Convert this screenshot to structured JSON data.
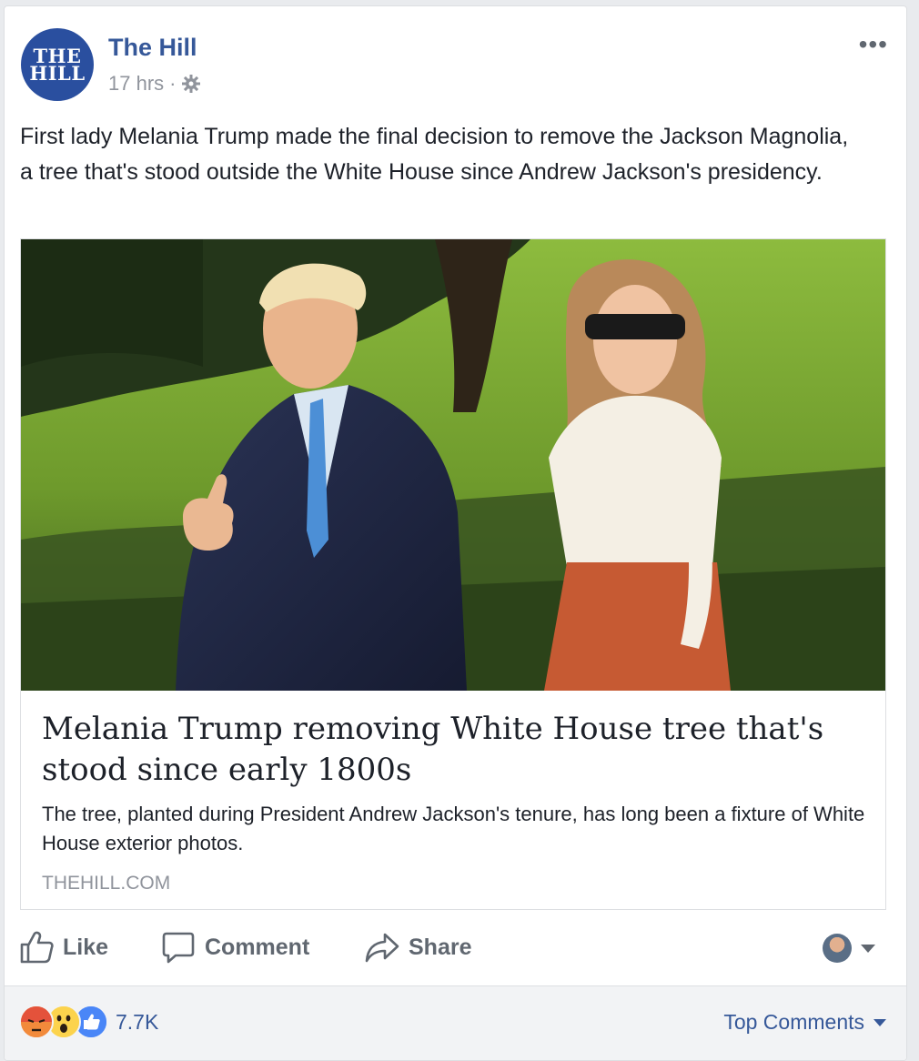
{
  "post": {
    "page_name": "The Hill",
    "avatar_text_line1": "THE",
    "avatar_text_line2": "HILL",
    "timestamp": "17 hrs",
    "separator": "·",
    "privacy_icon": "gear-icon",
    "more_label": "•••",
    "text": "First lady Melania Trump made the final decision to remove the Jackson Magnolia, a tree that's stood outside the White House since Andrew Jackson's presidency."
  },
  "link_preview": {
    "image_icon": "photo",
    "title": "Melania Trump removing White House tree that's stood since early 1800s",
    "description": "The tree, planted during President Andrew Jackson's tenure, has long been a fixture of White House exterior photos.",
    "domain": "THEHILL.COM"
  },
  "actions": {
    "like_label": "Like",
    "comment_label": "Comment",
    "share_label": "Share"
  },
  "footer": {
    "reaction_count": "7.7K",
    "reactions": [
      "angry-icon",
      "wow-icon",
      "like-icon"
    ],
    "sort_label": "Top Comments"
  },
  "colors": {
    "brand_blue": "#365899",
    "avatar_blue": "#2a4f9f",
    "muted_text": "#90949c",
    "action_text": "#606770"
  }
}
